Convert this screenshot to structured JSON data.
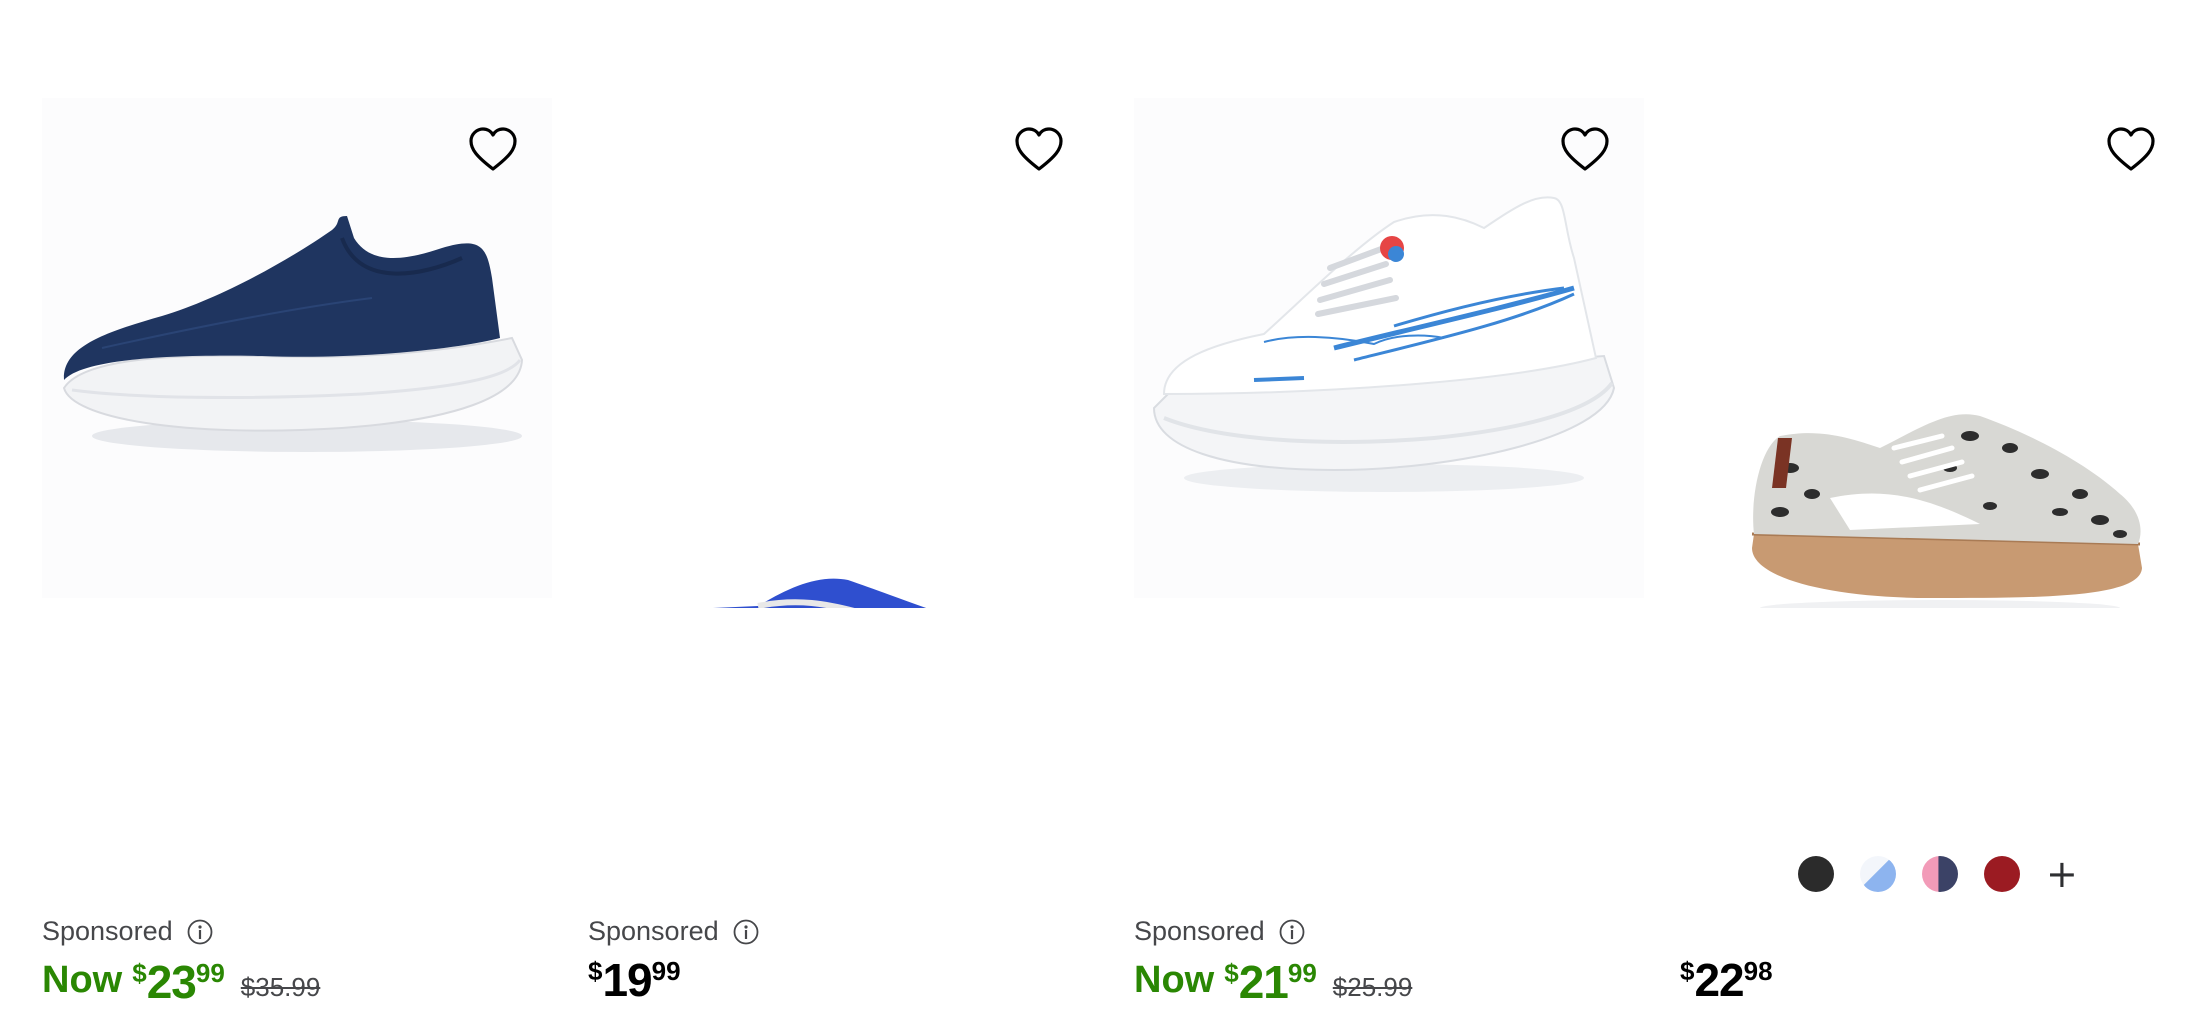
{
  "products": [
    {
      "sponsored_label": "Sponsored",
      "now_label": "Now",
      "currency": "$",
      "price_dollars": "23",
      "price_cents": "99",
      "was_price": "$35.99",
      "image": "navy-mesh-slip-on-sneaker",
      "favorite_icon": "heart-outline-icon"
    },
    {
      "sponsored_label": "Sponsored",
      "currency": "$",
      "price_dollars": "19",
      "price_cents": "99",
      "image": "blue-canvas-studded-platform-sneaker",
      "favorite_icon": "heart-outline-icon"
    },
    {
      "sponsored_label": "Sponsored",
      "now_label": "Now",
      "currency": "$",
      "price_dollars": "21",
      "price_cents": "99",
      "was_price": "$25.99",
      "image": "white-blue-running-sneaker",
      "favorite_icon": "heart-outline-icon"
    },
    {
      "currency": "$",
      "price_dollars": "22",
      "price_cents": "98",
      "image": "snakeskin-print-sneaker",
      "favorite_icon": "heart-outline-icon",
      "swatches": [
        "black",
        "light-blue",
        "pink-navy",
        "burgundy"
      ],
      "more_swatches_label": "+"
    }
  ],
  "colors": {
    "sale_price": "#2a8703",
    "regular_price": "#000000",
    "muted_text": "#46474a"
  }
}
